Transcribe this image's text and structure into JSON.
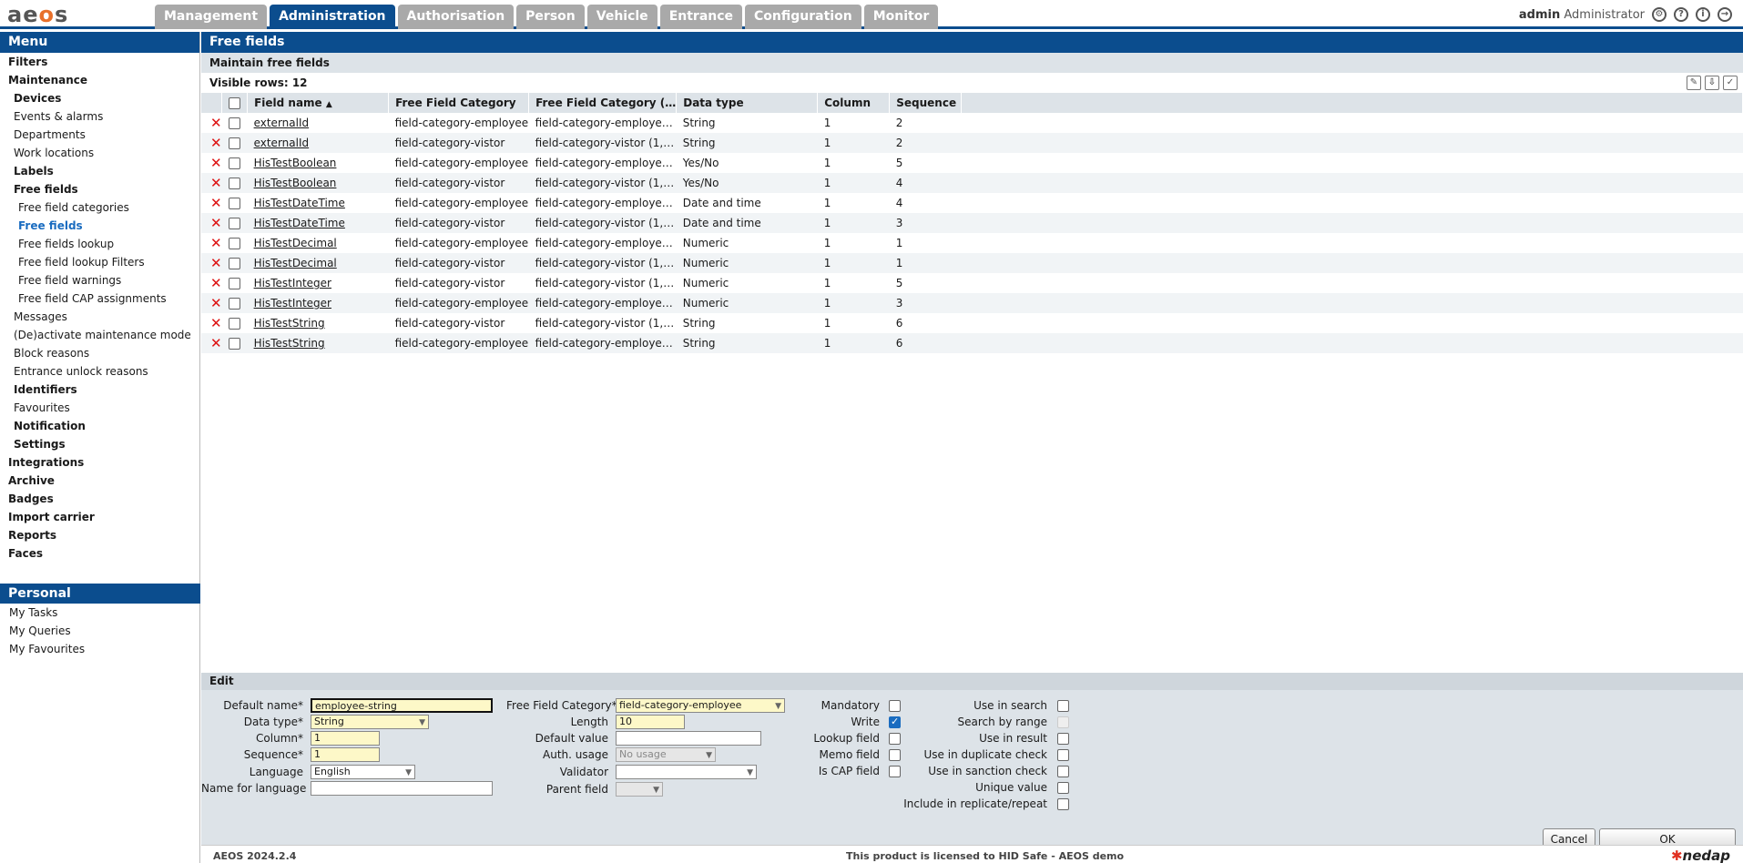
{
  "app": {
    "logo": "aeos"
  },
  "tabs": [
    "Management",
    "Administration",
    "Authorisation",
    "Person",
    "Vehicle",
    "Entrance",
    "Configuration",
    "Monitor"
  ],
  "active_tab": "Administration",
  "user": {
    "name": "admin",
    "role": "Administrator"
  },
  "sidebar": {
    "title": "Menu",
    "items": [
      {
        "label": "Filters"
      },
      {
        "label": "Maintenance"
      },
      {
        "label": "Devices"
      },
      {
        "label": "Events & alarms"
      },
      {
        "label": "Departments"
      },
      {
        "label": "Work locations"
      },
      {
        "label": "Labels"
      },
      {
        "label": "Free fields"
      },
      {
        "label": "Free field categories"
      },
      {
        "label": "Free fields"
      },
      {
        "label": "Free fields lookup"
      },
      {
        "label": "Free field lookup Filters"
      },
      {
        "label": "Free field warnings"
      },
      {
        "label": "Free field CAP assignments"
      },
      {
        "label": "Messages"
      },
      {
        "label": "(De)activate maintenance mode"
      },
      {
        "label": "Block reasons"
      },
      {
        "label": "Entrance unlock reasons"
      },
      {
        "label": "Identifiers"
      },
      {
        "label": "Favourites"
      },
      {
        "label": "Notification"
      },
      {
        "label": "Settings"
      },
      {
        "label": "Integrations"
      },
      {
        "label": "Archive"
      },
      {
        "label": "Badges"
      },
      {
        "label": "Import carrier"
      },
      {
        "label": "Reports"
      },
      {
        "label": "Faces"
      }
    ],
    "personal_title": "Personal",
    "personal_items": [
      "My Tasks",
      "My Queries",
      "My Favourites"
    ]
  },
  "main": {
    "title": "Free fields",
    "subtitle": "Maintain free fields",
    "visible_rows_label": "Visible rows: 12",
    "columns": [
      "Field name",
      "Free Field Category",
      "Free Field Category (…",
      "Data type",
      "Column",
      "Sequence"
    ],
    "rows": [
      {
        "name": "externalId",
        "category": "field-category-employee",
        "category2": "field-category-employe…",
        "type": "String",
        "column": "1",
        "sequence": "2"
      },
      {
        "name": "externalId",
        "category": "field-category-vistor",
        "category2": "field-category-vistor (1,…",
        "type": "String",
        "column": "1",
        "sequence": "2"
      },
      {
        "name": "HisTestBoolean",
        "category": "field-category-employee",
        "category2": "field-category-employe…",
        "type": "Yes/No",
        "column": "1",
        "sequence": "5"
      },
      {
        "name": "HisTestBoolean",
        "category": "field-category-vistor",
        "category2": "field-category-vistor (1,…",
        "type": "Yes/No",
        "column": "1",
        "sequence": "4"
      },
      {
        "name": "HisTestDateTime",
        "category": "field-category-employee",
        "category2": "field-category-employe…",
        "type": "Date and time",
        "column": "1",
        "sequence": "4"
      },
      {
        "name": "HisTestDateTime",
        "category": "field-category-vistor",
        "category2": "field-category-vistor (1,…",
        "type": "Date and time",
        "column": "1",
        "sequence": "3"
      },
      {
        "name": "HisTestDecimal",
        "category": "field-category-employee",
        "category2": "field-category-employe…",
        "type": "Numeric",
        "column": "1",
        "sequence": "1"
      },
      {
        "name": "HisTestDecimal",
        "category": "field-category-vistor",
        "category2": "field-category-vistor (1,…",
        "type": "Numeric",
        "column": "1",
        "sequence": "1"
      },
      {
        "name": "HisTestInteger",
        "category": "field-category-vistor",
        "category2": "field-category-vistor (1,…",
        "type": "Numeric",
        "column": "1",
        "sequence": "5"
      },
      {
        "name": "HisTestInteger",
        "category": "field-category-employee",
        "category2": "field-category-employe…",
        "type": "Numeric",
        "column": "1",
        "sequence": "3"
      },
      {
        "name": "HisTestString",
        "category": "field-category-vistor",
        "category2": "field-category-vistor (1,…",
        "type": "String",
        "column": "1",
        "sequence": "6"
      },
      {
        "name": "HisTestString",
        "category": "field-category-employee",
        "category2": "field-category-employe…",
        "type": "String",
        "column": "1",
        "sequence": "6"
      }
    ]
  },
  "edit": {
    "title": "Edit",
    "default_name_label": "Default name*",
    "default_name": "employee-string",
    "data_type_label": "Data type*",
    "data_type": "String",
    "column_label": "Column*",
    "column": "1",
    "sequence_label": "Sequence*",
    "sequence": "1",
    "language_label": "Language",
    "language": "English",
    "name_for_language_label": "Name for language",
    "name_for_language": "",
    "category_label": "Free Field Category*",
    "category": "field-category-employee",
    "length_label": "Length",
    "length": "10",
    "default_value_label": "Default value",
    "default_value": "",
    "auth_usage_label": "Auth. usage",
    "auth_usage": "No usage",
    "validator_label": "Validator",
    "validator": "",
    "parent_field_label": "Parent field",
    "parent_field": "",
    "mandatory_label": "Mandatory",
    "write_label": "Write",
    "lookup_label": "Lookup field",
    "memo_label": "Memo field",
    "cap_label": "Is CAP field",
    "use_in_search_label": "Use in search",
    "search_by_range_label": "Search by range",
    "use_in_result_label": "Use in result",
    "use_in_duplicate_label": "Use in duplicate check",
    "use_in_sanction_label": "Use in sanction check",
    "unique_label": "Unique value",
    "replicate_label": "Include in replicate/repeat",
    "cancel": "Cancel",
    "ok": "OK"
  },
  "status": {
    "version": "AEOS 2024.2.4",
    "license": "This product is licensed to HID Safe - AEOS demo",
    "brand": "nedap"
  },
  "colors": {
    "brand_blue": "#0b4d8e",
    "delete_red": "#dd1111",
    "required_yellow": "#fdf8c8"
  }
}
